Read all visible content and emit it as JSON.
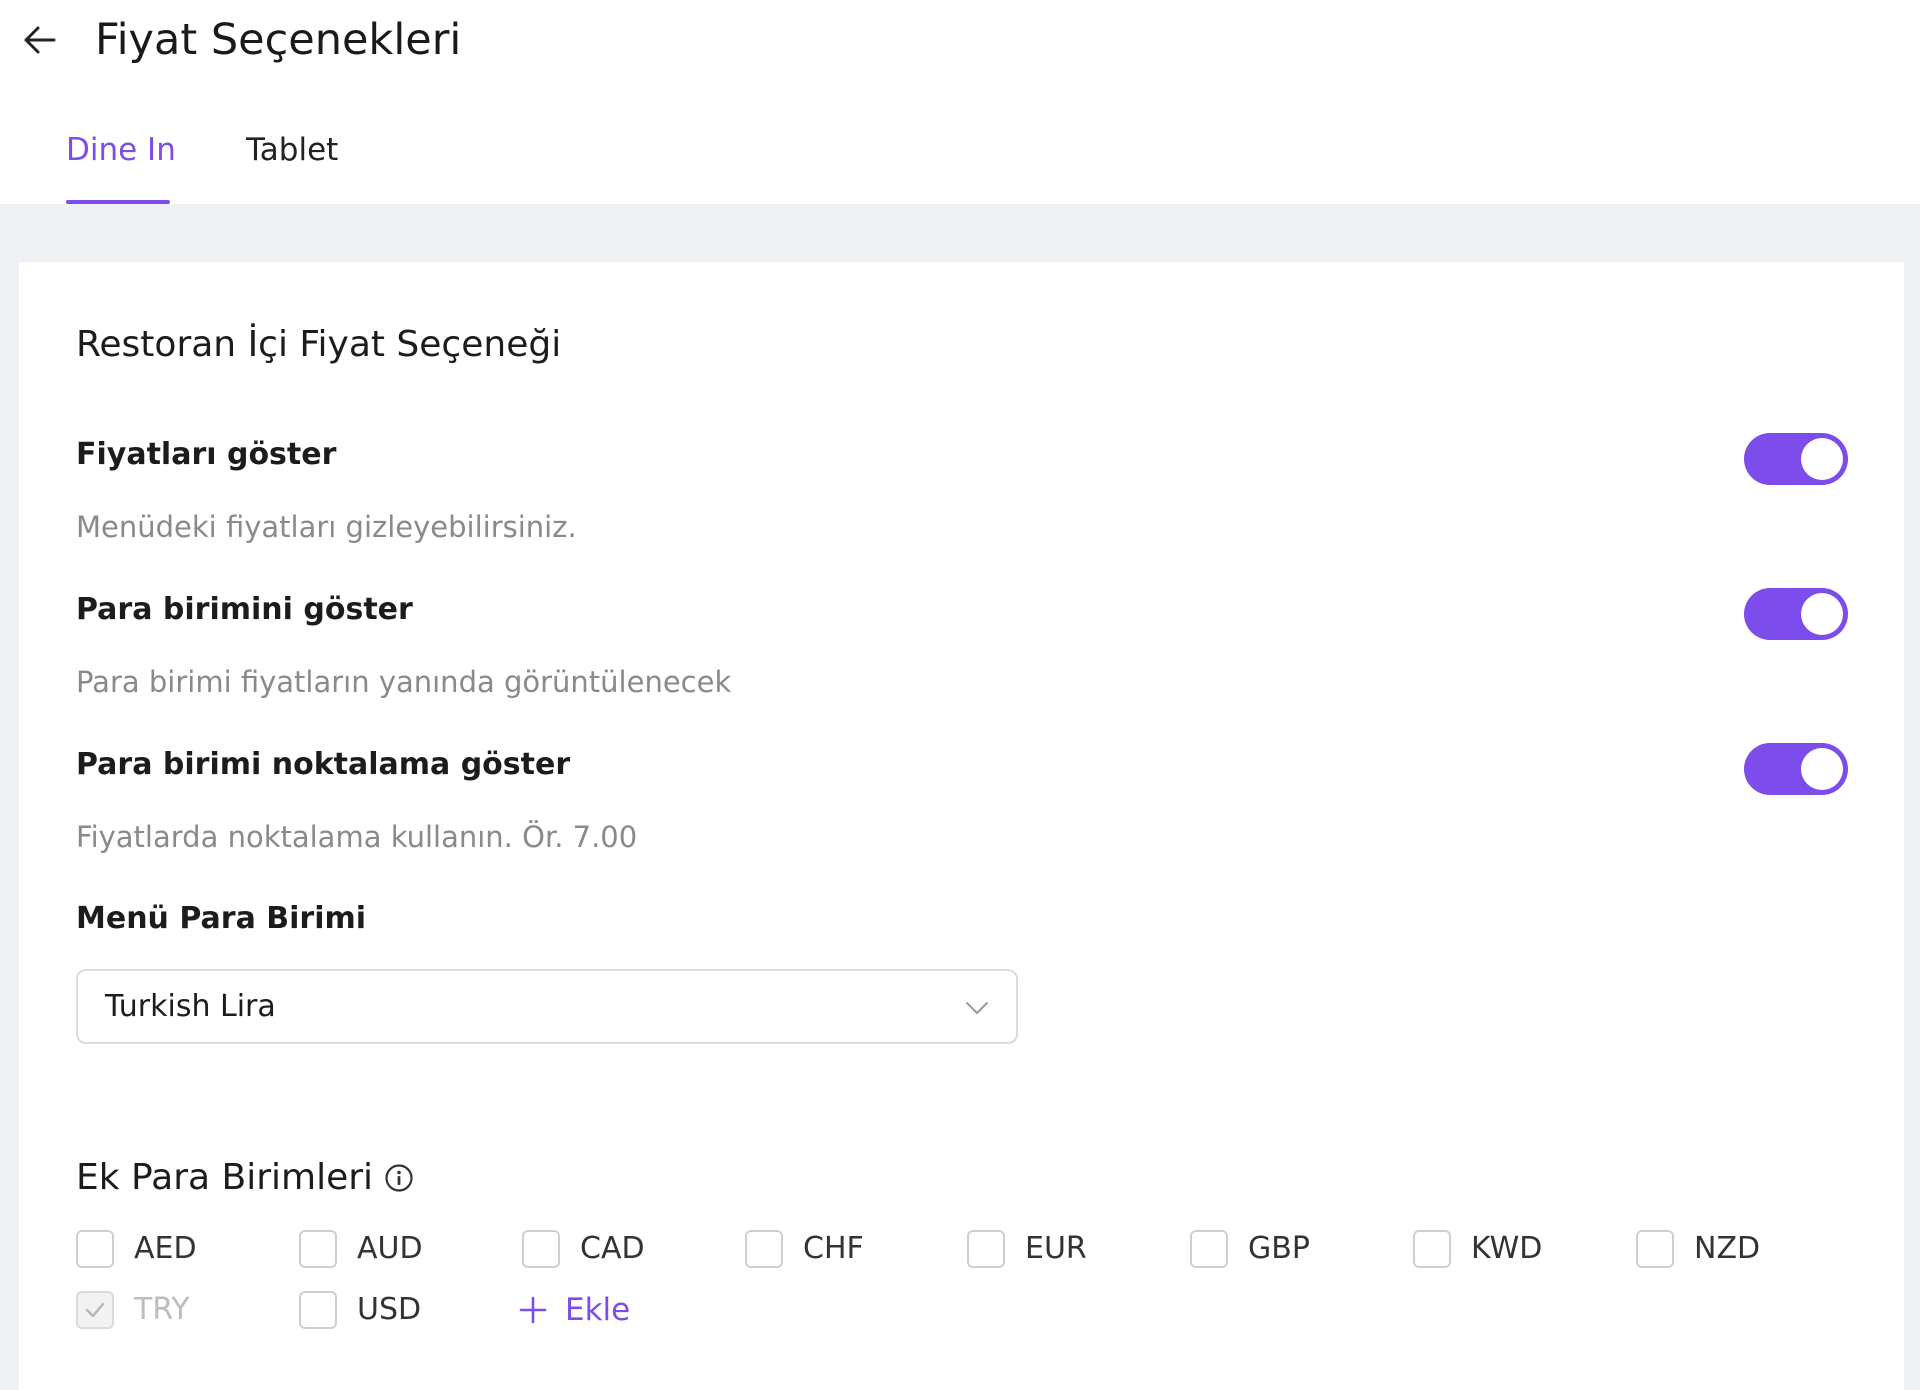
{
  "header": {
    "title": "Fiyat Seçenekleri",
    "back_icon": "arrow-left-icon"
  },
  "tabs": [
    {
      "label": "Dine In",
      "active": true
    },
    {
      "label": "Tablet",
      "active": false
    }
  ],
  "card": {
    "section_title": "Restoran İçi Fiyat Seçeneği",
    "options": [
      {
        "label": "Fiyatları göster",
        "description": "Menüdeki fiyatları gizleyebilirsiniz.",
        "enabled": true
      },
      {
        "label": "Para birimini göster",
        "description": "Para birimi fiyatların yanında görüntülenecek",
        "enabled": true
      },
      {
        "label": "Para birimi noktalama göster",
        "description": "Fiyatlarda noktalama kullanın. Ör. 7.00",
        "enabled": true
      }
    ],
    "menu_currency": {
      "label": "Menü Para Birimi",
      "selected": "Turkish Lira"
    },
    "extra_currencies": {
      "title": "Ek Para Birimleri",
      "items": [
        {
          "code": "AED",
          "checked": false,
          "disabled": false
        },
        {
          "code": "AUD",
          "checked": false,
          "disabled": false
        },
        {
          "code": "CAD",
          "checked": false,
          "disabled": false
        },
        {
          "code": "CHF",
          "checked": false,
          "disabled": false
        },
        {
          "code": "EUR",
          "checked": false,
          "disabled": false
        },
        {
          "code": "GBP",
          "checked": false,
          "disabled": false
        },
        {
          "code": "KWD",
          "checked": false,
          "disabled": false
        },
        {
          "code": "NZD",
          "checked": false,
          "disabled": false
        },
        {
          "code": "TRY",
          "checked": true,
          "disabled": true
        },
        {
          "code": "USD",
          "checked": false,
          "disabled": false
        }
      ],
      "add_label": "Ekle"
    }
  },
  "colors": {
    "accent": "#7c4dea",
    "page_background": "#f0f1f5",
    "muted_text": "#8a8a8a"
  }
}
